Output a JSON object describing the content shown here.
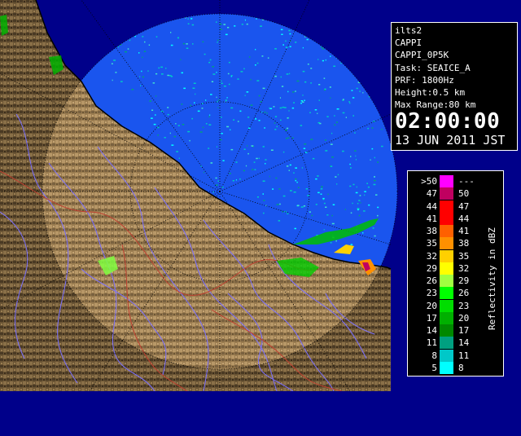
{
  "info": {
    "station": "ilts2",
    "product": "CAPPI",
    "product_code": "CAPPI_0P5K",
    "task": "Task: SEAICE_A",
    "prf": "PRF: 1800Hz",
    "height": "Height:0.5 km",
    "max_range": "Max Range:80 km",
    "time": "02:00:00",
    "date": "13 JUN 2011 JST"
  },
  "legend": {
    "unit_label": "Reflectivity in dBZ",
    "rows": [
      {
        "lo": ">50",
        "hi": "---",
        "color": "#ff00ff"
      },
      {
        "lo": "47",
        "hi": "50",
        "color": "#c00060"
      },
      {
        "lo": "44",
        "hi": "47",
        "color": "#ff0000"
      },
      {
        "lo": "41",
        "hi": "44",
        "color": "#ff0000"
      },
      {
        "lo": "38",
        "hi": "41",
        "color": "#ff6000"
      },
      {
        "lo": "35",
        "hi": "38",
        "color": "#ff9000"
      },
      {
        "lo": "32",
        "hi": "35",
        "color": "#ffd000"
      },
      {
        "lo": "29",
        "hi": "32",
        "color": "#ffff00"
      },
      {
        "lo": "26",
        "hi": "29",
        "color": "#a0ff40"
      },
      {
        "lo": "23",
        "hi": "26",
        "color": "#00ff00"
      },
      {
        "lo": "20",
        "hi": "23",
        "color": "#00dd00"
      },
      {
        "lo": "17",
        "hi": "20",
        "color": "#00b000"
      },
      {
        "lo": "14",
        "hi": "17",
        "color": "#008800"
      },
      {
        "lo": "11",
        "hi": "14",
        "color": "#00a080"
      },
      {
        "lo": "8",
        "hi": "11",
        "color": "#00c8c8"
      },
      {
        "lo": "5",
        "hi": "8",
        "color": "#00ffff"
      }
    ]
  },
  "colors": {
    "background": "#00008a",
    "radar_disc": "#1a55ee",
    "terrain_dark": "#4a3a24",
    "terrain_light": "#a88858",
    "rivers": "#7a70ff",
    "coast": "#000000"
  }
}
